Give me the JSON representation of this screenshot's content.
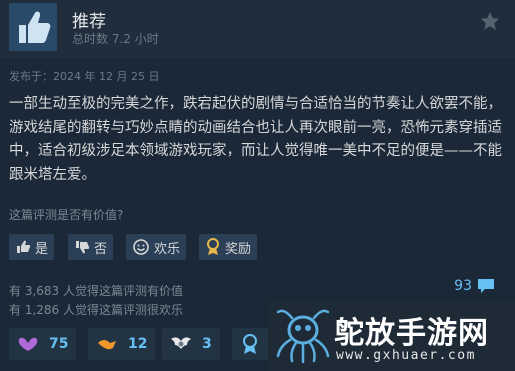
{
  "header": {
    "title": "推荐",
    "hours": "总时数 7.2 小时"
  },
  "review": {
    "posted": "发布于：2024 年 12 月 25 日",
    "text": "一部生动至极的完美之作，跌宕起伏的剧情与合适恰当的节奏让人欲罢不能，游戏结尾的翻转与巧妙点睛的动画结合也让人再次眼前一亮，恐怖元素穿插适中，适合初级涉足本领域游戏玩家，而让人觉得唯一美中不足的便是——不能跟米塔左爱。"
  },
  "feedback": {
    "question": "这篇评测是否有价值?",
    "yes_label": "是",
    "no_label": "否",
    "funny_label": "欢乐",
    "award_label": "奖励"
  },
  "stats": {
    "helpful": "有 3,683 人觉得这篇评测有价值",
    "funny": "有 1,286 人觉得这篇评测很欢乐",
    "comments": "93"
  },
  "awards": [
    {
      "icon": "purple-award-icon",
      "count": "75"
    },
    {
      "icon": "orange-award-icon",
      "count": "12"
    },
    {
      "icon": "wings-award-icon",
      "count": "3"
    },
    {
      "icon": "medal-award-icon",
      "count": ""
    }
  ],
  "watermark": {
    "text": "鸵放手游网",
    "url": "www.gxhuaer.com"
  },
  "colors": {
    "background": "#1b2838",
    "header": "#202d3c",
    "button": "#2b4056",
    "accent": "#66c0f4"
  }
}
